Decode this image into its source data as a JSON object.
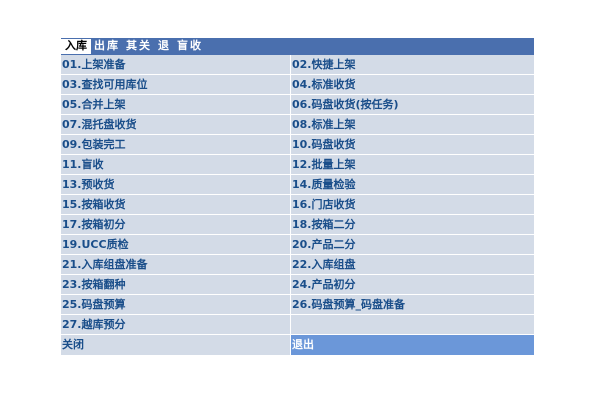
{
  "tabs": [
    {
      "label": "入库",
      "active": true
    },
    {
      "label": "出库",
      "active": false
    },
    {
      "label": "其关",
      "active": false
    },
    {
      "label": "退",
      "active": false
    },
    {
      "label": "盲收",
      "active": false
    }
  ],
  "menu_items": [
    "01.上架准备",
    "02.快捷上架",
    "03.查找可用库位",
    "04.标准收货",
    "05.合并上架",
    "06.码盘收货(按任务)",
    "07.混托盘收货",
    "08.标准上架",
    "09.包装完工",
    "10.码盘收货",
    "11.盲收",
    "12.批量上架",
    "13.预收货",
    "14.质量检验",
    "15.按箱收货",
    "16.门店收货",
    "17.按箱初分",
    "18.按箱二分",
    "19.UCC质检",
    "20.产品二分",
    "21.入库组盘准备",
    "22.入库组盘",
    "23.按箱翻种",
    "24.产品初分",
    "25.码盘预算",
    "26.码盘预算_码盘准备",
    "27.越库预分",
    ""
  ],
  "footer": {
    "close_label": "关闭",
    "exit_label": "退出"
  },
  "colors": {
    "header_bg": "#4a6fae",
    "cell_bg": "#d3dbe7",
    "cell_text": "#1a4e8a",
    "exit_bg": "#6b97d9"
  }
}
